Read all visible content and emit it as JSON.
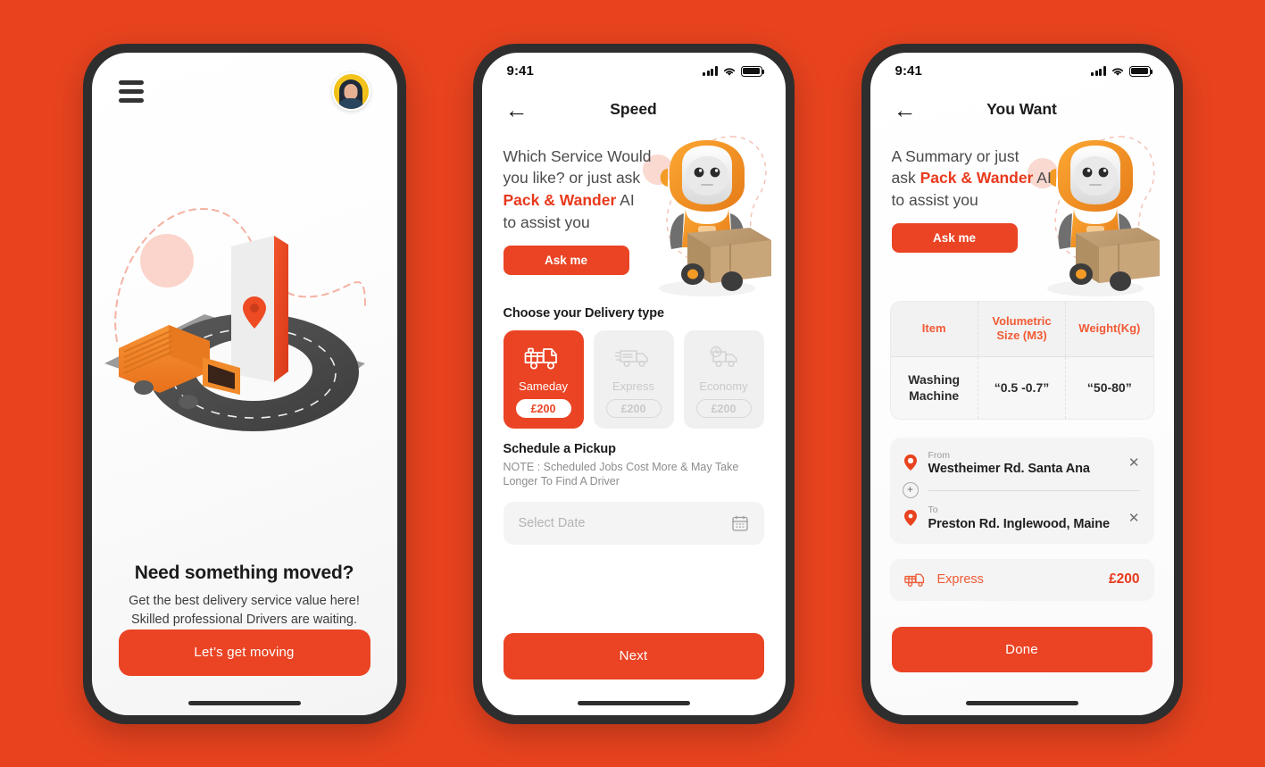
{
  "theme": {
    "background": "#E8431F",
    "accent": "#EA4424",
    "brand_red": "#E8391C",
    "muted": "#B4B4B4",
    "table_header": "#F15A34"
  },
  "phone1": {
    "menu_icon": "hamburger-menu-icon",
    "avatar_alt": "user-avatar",
    "illustration": "delivery-truck-road-phone-pin-3d",
    "title": "Need something moved?",
    "subtitle_line1": "Get the best delivery service value here!",
    "subtitle_line2": "Skilled professional Drivers are waiting.",
    "cta_label": "Let’s get moving"
  },
  "phone2": {
    "status": {
      "time": "9:41",
      "signal": "cellular-signal-icon",
      "wifi": "wifi-icon",
      "battery": "battery-full-icon"
    },
    "nav": {
      "back": "←",
      "title": "Speed"
    },
    "hero": {
      "line1": "Which Service Would",
      "line2": "you like? or just ask",
      "brand": "Pack & Wander",
      "line3_tail": " AI",
      "line4": "to assist you",
      "button": "Ask me",
      "robot_alt": "delivery-robot-with-box"
    },
    "delivery": {
      "section_title": "Choose your Delivery type",
      "options": [
        {
          "name": "Sameday",
          "price": "£200",
          "selected": true,
          "icon": "truck-crates-icon"
        },
        {
          "name": "Express",
          "price": "£200",
          "selected": false,
          "icon": "van-fast-icon"
        },
        {
          "name": "Economy",
          "price": "£200",
          "selected": false,
          "icon": "van-clock-icon"
        }
      ]
    },
    "schedule": {
      "title": "Schedule a Pickup",
      "note_line1": "NOTE : Scheduled Jobs Cost More & May Take Longer",
      "note_line2": "To Find A Driver",
      "date_placeholder": "Select Date",
      "date_value": "",
      "calendar_icon": "calendar-icon"
    },
    "cta_label": "Next"
  },
  "phone3": {
    "status": {
      "time": "9:41",
      "signal": "cellular-signal-icon",
      "wifi": "wifi-icon",
      "battery": "battery-full-icon"
    },
    "nav": {
      "back": "←",
      "title": "You Want"
    },
    "hero": {
      "line1": "A Summary or just",
      "line2_head": "ask ",
      "brand": "Pack & Wander",
      "line2_tail": " AI",
      "line3": "to assist you",
      "button": "Ask me",
      "robot_alt": "delivery-robot-with-box"
    },
    "table": {
      "headers": [
        "Item",
        "Volumetric Size (M3)",
        "Weight(Kg)"
      ],
      "headers_split": [
        {
          "l1": "Item",
          "l2": ""
        },
        {
          "l1": "Volumetric",
          "l2": "Size (M3)"
        },
        {
          "l1": "Weight(Kg)",
          "l2": ""
        }
      ],
      "rows": [
        {
          "item_l1": "Washing",
          "item_l2": "Machine",
          "volume": "“0.5 -0.7”",
          "weight": "“50-80”"
        }
      ]
    },
    "route": {
      "from_label": "From",
      "from_value": "Westheimer Rd. Santa Ana",
      "to_label": "To",
      "to_value": "Preston Rd. Inglewood, Maine",
      "remove_icon": "close-x-icon",
      "add_icon": "add-stop-icon"
    },
    "summary": {
      "icon": "truck-icon",
      "label": "Express",
      "amount": "£200"
    },
    "cta_label": "Done"
  }
}
